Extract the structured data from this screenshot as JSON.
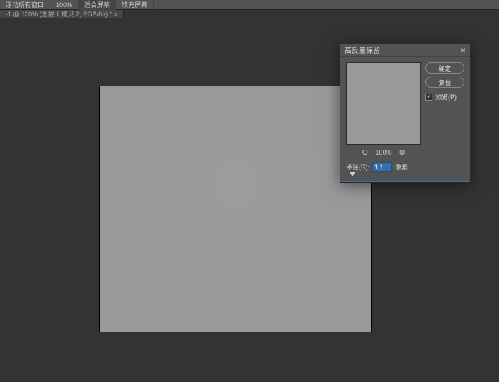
{
  "toolbar": {
    "btn_float_all": "浮动所有窗口",
    "zoom_pct": "100%",
    "btn_fit_screen": "适合屏幕",
    "btn_fill_screen": "填充屏幕"
  },
  "tab": {
    "label": "-1 @ 100% (图层 1 拷贝 2, RGB/8#) * ×"
  },
  "dialog": {
    "title": "高反差保留",
    "ok": "确定",
    "cancel": "复位",
    "preview_label": "预览(P)",
    "zoom_pct": "100%",
    "radius_label": "半径(R):",
    "radius_value": "1.1",
    "radius_unit": "像素"
  }
}
